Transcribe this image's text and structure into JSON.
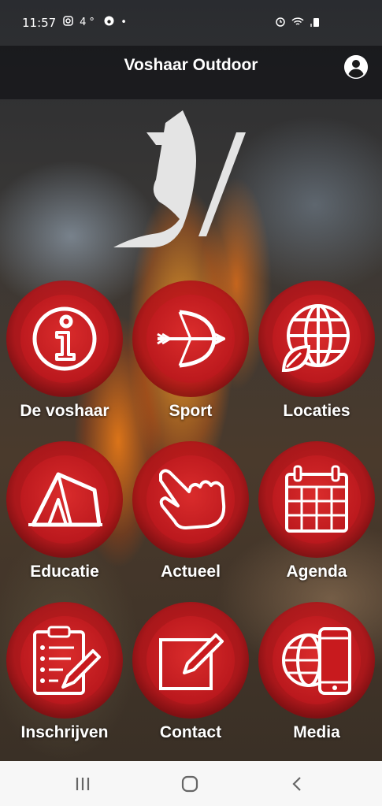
{
  "status_bar": {
    "time": "11:57",
    "left_icons": [
      "instagram-icon",
      "weather-icon",
      "face-icon",
      "dot"
    ],
    "temperature": "4°",
    "right_icons": [
      "alarm-icon",
      "wifi-icon",
      "signal-icon",
      "battery-icon"
    ]
  },
  "header": {
    "title": "Voshaar Outdoor",
    "profile_icon": "account-icon"
  },
  "menu": [
    {
      "label": "De voshaar",
      "icon": "info-icon"
    },
    {
      "label": "Sport",
      "icon": "bow-arrow-icon"
    },
    {
      "label": "Locaties",
      "icon": "globe-leaf-icon"
    },
    {
      "label": "Educatie",
      "icon": "tent-icon"
    },
    {
      "label": "Actueel",
      "icon": "pointing-hand-icon"
    },
    {
      "label": "Agenda",
      "icon": "calendar-icon"
    },
    {
      "label": "Inschrijven",
      "icon": "clipboard-pen-icon"
    },
    {
      "label": "Contact",
      "icon": "edit-icon"
    },
    {
      "label": "Media",
      "icon": "globe-phone-icon"
    }
  ],
  "colors": {
    "accent_red": "#c8161c",
    "header_bg": "#141416",
    "navbar_bg": "#f7f7f7"
  },
  "navbar": [
    "recents-icon",
    "home-icon",
    "back-icon"
  ]
}
